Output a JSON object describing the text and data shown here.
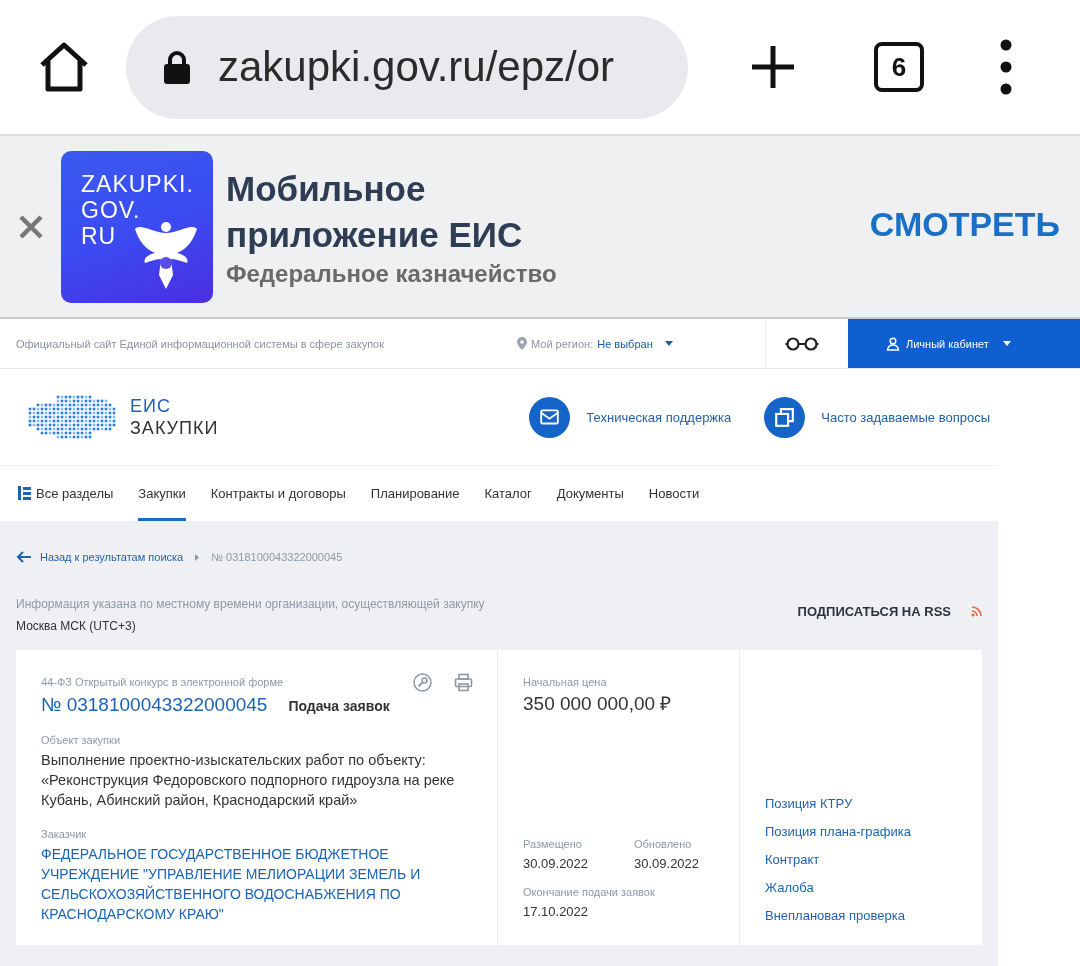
{
  "browser": {
    "url": "zakupki.gov.ru/epz/or",
    "tab_count": "6"
  },
  "app_banner": {
    "icon_text": [
      "ZAKUPKI.",
      "GOV.",
      "RU"
    ],
    "title": "Мобильное приложение ЕИС",
    "subtitle": "Федеральное казначейство",
    "action": "СМОТРЕТЬ"
  },
  "site_header": {
    "tagline": "Официальный сайт Единой информационной системы в сфере закупок",
    "region_label": "Мой регион:",
    "region_value": "Не выбран",
    "account": "Личный кабинет"
  },
  "logo": {
    "line1": "ЕИС",
    "line2": "ЗАКУПКИ"
  },
  "help_links": [
    {
      "kind": "mail",
      "label": "Техническая поддержка"
    },
    {
      "kind": "faq",
      "label": "Часто задаваемые вопросы"
    }
  ],
  "nav": [
    {
      "kind": "all",
      "label": "Все разделы",
      "selected": false
    },
    {
      "kind": "tab",
      "label": "Закупки",
      "selected": true
    },
    {
      "kind": "tab",
      "label": "Контракты и договоры",
      "selected": false
    },
    {
      "kind": "tab",
      "label": "Планирование",
      "selected": false
    },
    {
      "kind": "tab",
      "label": "Каталог",
      "selected": false
    },
    {
      "kind": "tab",
      "label": "Документы",
      "selected": false
    },
    {
      "kind": "tab",
      "label": "Новости",
      "selected": false
    }
  ],
  "breadcrumb": {
    "back": "Назад к результатам поиска",
    "current": "№ 0318100043322000045"
  },
  "time_note": {
    "text": "Информация указана по местному времени организации, осуществляющей закупку",
    "zone": "Москва МСК (UTC+3)"
  },
  "rss": "ПОДПИСАТЬСЯ НА RSS",
  "purchase": {
    "law_type": "44-ФЗ Открытый конкурс в электронной форме",
    "number": "№ 0318100043322000045",
    "stage": "Подача заявок",
    "object_label": "Объект закупки",
    "object": "Выполнение проектно-изыскательских работ по объекту: «Реконструкция Федоровского подпорного гидроузла на реке Кубань, Абинский район, Краснодарский край»",
    "customer_label": "Заказчик",
    "customer": "ФЕДЕРАЛЬНОЕ ГОСУДАРСТВЕННОЕ БЮДЖЕТНОЕ УЧРЕЖДЕНИЕ \"УПРАВЛЕНИЕ МЕЛИОРАЦИИ ЗЕМЕЛЬ И СЕЛЬСКОХОЗЯЙСТВЕННОГО ВОДОСНАБЖЕНИЯ ПО КРАСНОДАРСКОМУ КРАЮ\"",
    "price_label": "Начальная цена",
    "price": "350 000 000,00 ₽",
    "dates": [
      {
        "label": "Размещено",
        "value": "30.09.2022"
      },
      {
        "label": "Обновлено",
        "value": "30.09.2022"
      },
      {
        "label": "Окончание подачи заявок",
        "value": "17.10.2022"
      }
    ],
    "links": [
      "Позиция КТРУ",
      "Позиция плана-графика",
      "Контракт",
      "Жалоба",
      "Внеплановая проверка"
    ]
  }
}
